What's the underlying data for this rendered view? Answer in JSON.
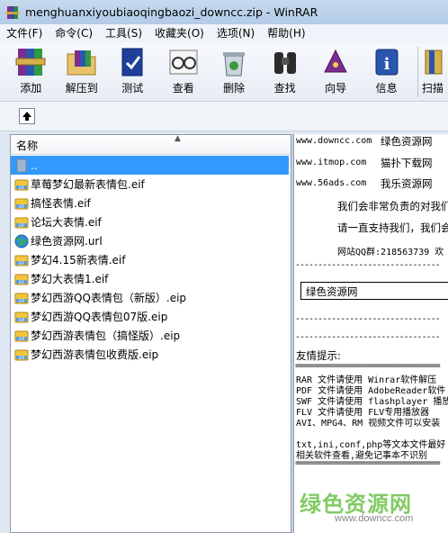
{
  "window": {
    "title": "menghuanxiyoubiaoqingbaozi_downcc.zip - WinRAR"
  },
  "menubar": {
    "items": [
      "文件(F)",
      "命令(C)",
      "工具(S)",
      "收藏夹(O)",
      "选项(N)",
      "帮助(H)"
    ]
  },
  "toolbar": {
    "buttons": [
      {
        "label": "添加",
        "icon": "books-add-icon"
      },
      {
        "label": "解压到",
        "icon": "folder-extract-icon"
      },
      {
        "label": "测试",
        "icon": "test-book-icon"
      },
      {
        "label": "查看",
        "icon": "view-glasses-icon"
      },
      {
        "label": "删除",
        "icon": "delete-recycle-icon"
      },
      {
        "label": "查找",
        "icon": "find-binoculars-icon"
      },
      {
        "label": "向导",
        "icon": "wizard-icon"
      },
      {
        "label": "信息",
        "icon": "info-icon"
      },
      {
        "label": "扫描",
        "icon": "scan-icon"
      }
    ]
  },
  "filelist": {
    "column_name": "名称",
    "rows": [
      {
        "name": "..",
        "type": "parent",
        "selected": true
      },
      {
        "name": "草莓梦幻最新表情包.eif",
        "type": "eif"
      },
      {
        "name": "搞怪表情.eif",
        "type": "eif"
      },
      {
        "name": "论坛大表情.eif",
        "type": "eif"
      },
      {
        "name": "绿色资源网.url",
        "type": "url"
      },
      {
        "name": "梦幻4.15新表情.eif",
        "type": "eif"
      },
      {
        "name": "梦幻大表情1.eif",
        "type": "eif"
      },
      {
        "name": "梦幻西游QQ表情包（新版）.eip",
        "type": "eip"
      },
      {
        "name": "梦幻西游QQ表情包07版.eip",
        "type": "eip"
      },
      {
        "name": "梦幻西游表情包（搞怪版）.eip",
        "type": "eip"
      },
      {
        "name": "梦幻西游表情包收费版.eip",
        "type": "eip"
      }
    ]
  },
  "preview": {
    "site1_url": "www.downcc.com",
    "site1_name": "绿色资源网",
    "site2_url": "www.itmop.com",
    "site2_name": "猫扑下载网",
    "site3_url": "www.56ads.com",
    "site3_name": "我乐资源网",
    "line_responsible": "我们会非常负责的对我们",
    "line_support": "请一直支持我们，我们会",
    "line_qq": "网站QQ群:218563739  欢",
    "boxed_text": "绿色资源网",
    "tips_title": "友情提示:",
    "tip1": "RAR 文件请使用 Winrar软件解压",
    "tip2": "PDF 文件请使用 AdobeReader软件",
    "tip3": "SWF 文件请使用 flashplayer 播放",
    "tip4": "FLV 文件请使用 FLV专用播放器",
    "tip5": "AVI、MPG4、RM 视频文件可以安装",
    "tip6": "txt,ini,conf,php等文本文件最好",
    "tip7": "相关软件查看,避免记事本不识别",
    "separator": "================================",
    "dash_separator": "--------------------------------",
    "watermark_cn": "绿色资源网",
    "watermark_url": "www.downcc.com"
  }
}
